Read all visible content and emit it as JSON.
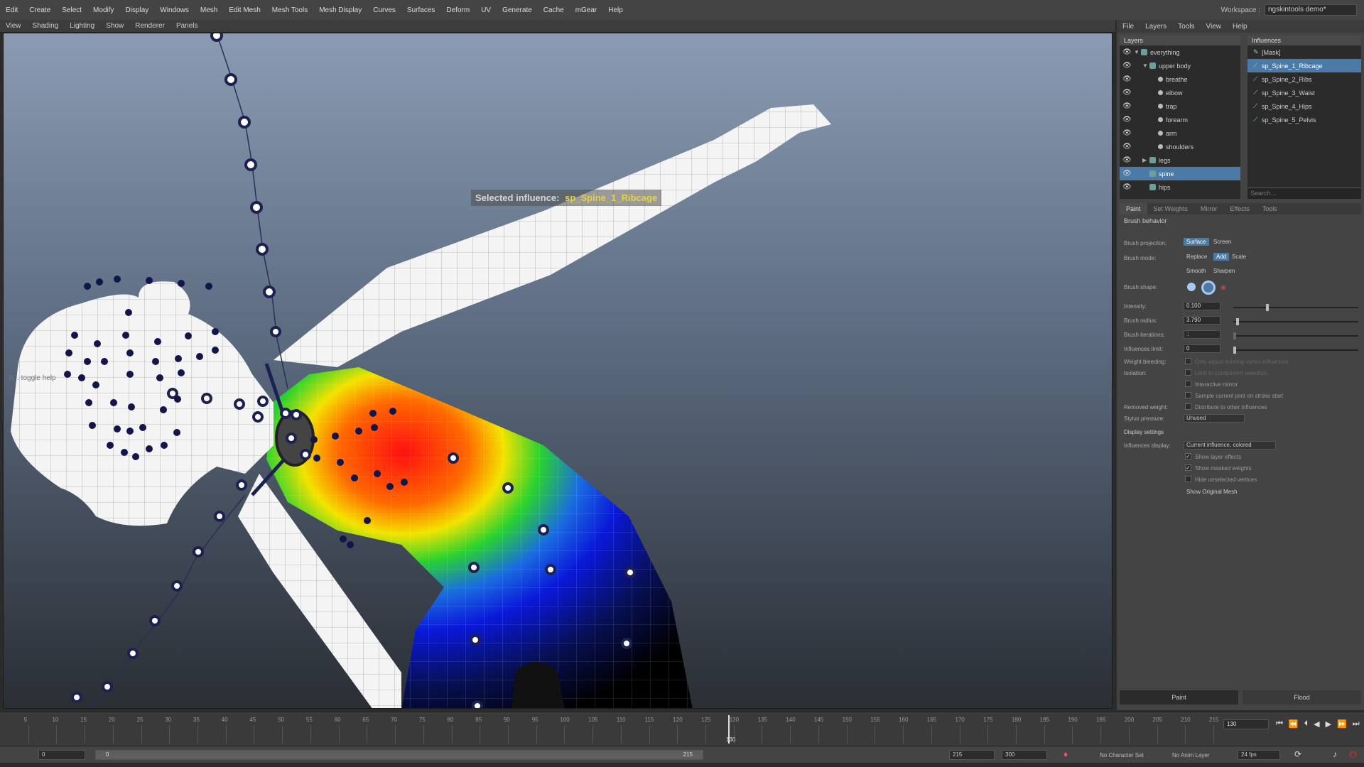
{
  "menu": [
    "Edit",
    "Create",
    "Select",
    "Modify",
    "Display",
    "Windows",
    "Mesh",
    "Edit Mesh",
    "Mesh Tools",
    "Mesh Display",
    "Curves",
    "Surfaces",
    "Deform",
    "UV",
    "Generate",
    "Cache",
    "mGear",
    "Help"
  ],
  "workspace": {
    "label": "Workspace :",
    "value": "ngskintools demo*"
  },
  "viewport_menu": [
    "View",
    "Shading",
    "Lighting",
    "Show",
    "Renderer",
    "Panels"
  ],
  "viewport": {
    "selected_influence_label": "Selected influence:",
    "selected_influence_name": "sp_Spine_1_Ribcage",
    "toggle_help": "h... toggle help"
  },
  "panel_menu": [
    "File",
    "Layers",
    "Tools",
    "View",
    "Help"
  ],
  "layers": {
    "title": "Layers",
    "items": [
      {
        "label": "everything",
        "level": 0,
        "arrow": "▼"
      },
      {
        "label": "upper body",
        "level": 1,
        "arrow": "▼"
      },
      {
        "label": "breathe",
        "level": 2,
        "arrow": ""
      },
      {
        "label": "elbow",
        "level": 2,
        "arrow": ""
      },
      {
        "label": "trap",
        "level": 2,
        "arrow": ""
      },
      {
        "label": "forearm",
        "level": 2,
        "arrow": ""
      },
      {
        "label": "arm",
        "level": 2,
        "arrow": ""
      },
      {
        "label": "shoulders",
        "level": 2,
        "arrow": ""
      },
      {
        "label": "legs",
        "level": 1,
        "arrow": "▶"
      },
      {
        "label": "spine",
        "level": 1,
        "arrow": ""
      },
      {
        "label": "hips",
        "level": 1,
        "arrow": ""
      }
    ],
    "selected": "spine"
  },
  "influences": {
    "title": "Influences",
    "items": [
      "[Mask]",
      "sp_Spine_1_Ribcage",
      "sp_Spine_2_Ribs",
      "sp_Spine_3_Waist",
      "sp_Spine_4_Hips",
      "sp_Spine_5_Pelvis"
    ],
    "selected": "sp_Spine_1_Ribcage",
    "search_placeholder": "Search..."
  },
  "tabs": [
    "Paint",
    "Set Weights",
    "Mirror",
    "Effects",
    "Tools"
  ],
  "active_tab": "Paint",
  "paint": {
    "brush_behavior": "Brush behavior",
    "projection_label": "Brush projection:",
    "projection_options": [
      "Surface",
      "Screen"
    ],
    "projection_value": "Surface",
    "mode_label": "Brush mode:",
    "mode_options": [
      "Replace",
      "Add",
      "Scale",
      "Smooth",
      "Sharpen"
    ],
    "mode_value": "Add",
    "shape_label": "Brush shape:",
    "intensity_label": "Intensity:",
    "intensity": "0.100",
    "radius_label": "Brush radius:",
    "radius": "3.790",
    "iterations_label": "Brush iterations:",
    "iterations": "1",
    "influences_limit_label": "Influences limit:",
    "influences_limit": "0",
    "weight_bleeding_label": "Weight bleeding:",
    "weight_bleeding_text": "Only adjust existing vertex influences",
    "isolation_label": "Isolation:",
    "limit_component": "Limit to component selection",
    "interactive_mirror": "Interactive mirror",
    "sample_joint": "Sample current joint on stroke start",
    "removed_weight_label": "Removed weight:",
    "distribute": "Distribute to other influences",
    "stylus_label": "Stylus pressure:",
    "stylus_value": "Unused",
    "display_settings": "Display settings",
    "influences_display_label": "Influences display:",
    "influences_display_value": "Current influence, colored",
    "show_layer_effects": "Show layer effects",
    "show_masked_weights": "Show masked weights",
    "hide_unselected": "Hide unselected vertices",
    "show_original_mesh": "Show Original Mesh",
    "paint_button": "Paint",
    "flood_button": "Flood"
  },
  "timeline": {
    "ticks": [
      "5",
      "10",
      "15",
      "20",
      "25",
      "30",
      "35",
      "40",
      "45",
      "50",
      "55",
      "60",
      "65",
      "70",
      "75",
      "80",
      "85",
      "90",
      "95",
      "100",
      "105",
      "110",
      "115",
      "120",
      "125",
      "130",
      "135",
      "140",
      "145",
      "150",
      "155",
      "160",
      "165",
      "170",
      "175",
      "180",
      "185",
      "190",
      "195",
      "200",
      "205",
      "210",
      "215"
    ],
    "current_frame": "130",
    "current_frame_field": "130"
  },
  "range": {
    "start_outer": "0",
    "start_inner": "0",
    "end_inner": "215",
    "end_field": "215",
    "end_outer": "300",
    "character_set": "No Character Set",
    "anim_layer": "No Anim Layer",
    "fps": "24 fps"
  },
  "colors": {
    "accent": "#4c7aa6",
    "highlight_text": "#e6d24a"
  }
}
